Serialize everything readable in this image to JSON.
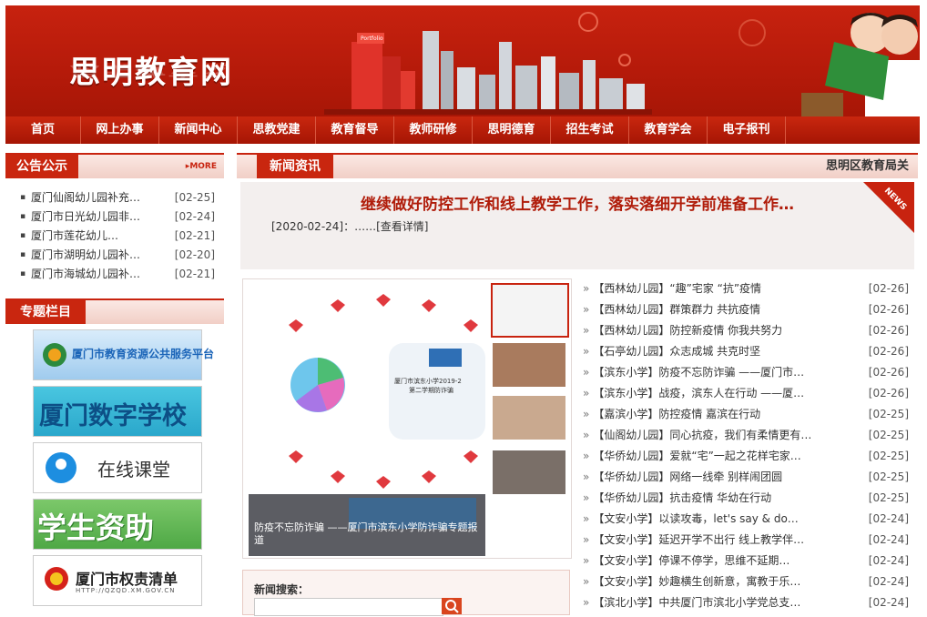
{
  "header": {
    "site_title": "思明教育网",
    "building_label": "Portfolio"
  },
  "nav": [
    "首页",
    "网上办事",
    "新闻中心",
    "思教党建",
    "教育督导",
    "教师研修",
    "思明德育",
    "招生考试",
    "教育学会",
    "电子报刊"
  ],
  "announce": {
    "tab": "公告公示",
    "more": "MORE",
    "items": [
      {
        "title": "厦门仙阁幼儿园补充…",
        "date": "[02-25]"
      },
      {
        "title": "厦门市日光幼儿园非…",
        "date": "[02-24]"
      },
      {
        "title": "厦门市莲花幼儿…",
        "date": "[02-21]"
      },
      {
        "title": "厦门市湖明幼儿园补…",
        "date": "[02-20]"
      },
      {
        "title": "厦门市海城幼儿园补…",
        "date": "[02-21]"
      }
    ]
  },
  "special": {
    "tab": "专题栏目",
    "banners": [
      {
        "text": "厦门市教育资源公共服务平台",
        "color": "#1a64b8"
      },
      {
        "text": "厦门数字学校",
        "color": "#1c6fa8"
      },
      {
        "text": "在线课堂",
        "color": "#333333"
      },
      {
        "text": "学生资助",
        "color": "#ffffff"
      },
      {
        "text": "厦门市权责清单",
        "sub": "HTTP://QZQD.XM.GOV.CN",
        "color": "#222222"
      }
    ]
  },
  "news": {
    "tab": "新闻资讯",
    "marquee": "思明区教育局关",
    "headline": "继续做好防控工作和线上教学工作，落实落细开学前准备工作…",
    "headline_date": "[2020-02-24]：……",
    "detail_link": "[查看详情]",
    "corner_badge": "NEWS",
    "photo_caption": "防疫不忘防诈骗 ——厦门市滨东小学防诈骗专题报道",
    "poster_title_1": "厦门市滨东小学2019-2",
    "poster_title_2": "第二学期防诈骗",
    "items": [
      {
        "tag": "【西林幼儿园】",
        "title": "“趣”宅家 “抗”疫情",
        "date": "[02-26]"
      },
      {
        "tag": "【西林幼儿园】",
        "title": "群策群力 共抗疫情",
        "date": "[02-26]"
      },
      {
        "tag": "【西林幼儿园】",
        "title": "防控新疫情 你我共努力",
        "date": "[02-26]"
      },
      {
        "tag": "【石亭幼儿园】",
        "title": "众志成城 共克时坚",
        "date": "[02-26]"
      },
      {
        "tag": "【滨东小学】",
        "title": "防疫不忘防诈骗 ——厦门市…",
        "date": "[02-26]"
      },
      {
        "tag": "【滨东小学】",
        "title": "战疫，滨东人在行动 ——厦…",
        "date": "[02-26]"
      },
      {
        "tag": "【嘉滨小学】",
        "title": "防控疫情 嘉滨在行动",
        "date": "[02-25]"
      },
      {
        "tag": "【仙阁幼儿园】",
        "title": "同心抗疫，我们有柔情更有…",
        "date": "[02-25]"
      },
      {
        "tag": "【华侨幼儿园】",
        "title": "爱就“宅”一起之花样宅家…",
        "date": "[02-25]"
      },
      {
        "tag": "【华侨幼儿园】",
        "title": "网络一线牵 别样闹团圆",
        "date": "[02-25]"
      },
      {
        "tag": "【华侨幼儿园】",
        "title": "抗击疫情 华幼在行动",
        "date": "[02-25]"
      },
      {
        "tag": "【文安小学】",
        "title": "以读攻毒，let's say & do…",
        "date": "[02-24]"
      },
      {
        "tag": "【文安小学】",
        "title": "延迟开学不出行 线上教学伴…",
        "date": "[02-24]"
      },
      {
        "tag": "【文安小学】",
        "title": "停课不停学，思维不延期…",
        "date": "[02-24]"
      },
      {
        "tag": "【文安小学】",
        "title": "妙趣横生创新意，寓教于乐…",
        "date": "[02-24]"
      },
      {
        "tag": "【滨北小学】",
        "title": "中共厦门市滨北小学党总支…",
        "date": "[02-24]"
      }
    ]
  },
  "search": {
    "label": "新闻搜索："
  },
  "colors": {
    "brand_red": "#c8230f",
    "headline_red": "#b01c0a"
  }
}
